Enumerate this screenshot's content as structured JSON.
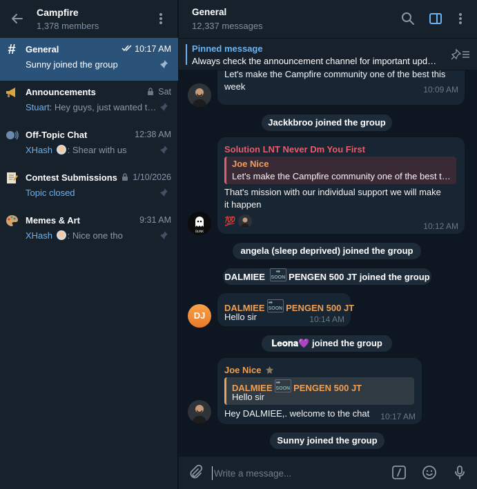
{
  "group": {
    "title": "Campfire",
    "members": "1,378 members"
  },
  "topics": [
    {
      "name": "General",
      "time": "10:17 AM",
      "preview": "Sunny joined the group",
      "icon": "#"
    },
    {
      "name": "Announcements",
      "time": "Sat",
      "sender": "Stuart:",
      "preview": " Hey guys, just wanted to share"
    },
    {
      "name": "Off-Topic Chat",
      "time": "12:38 AM",
      "sender": "XHash",
      "preview": ": Shear with us"
    },
    {
      "name": "Contest Submissions",
      "time": "1/10/2026",
      "preview": "Topic closed"
    },
    {
      "name": "Memes & Art",
      "time": "9:31 AM",
      "sender": "XHash",
      "preview": ": Nice one tho"
    }
  ],
  "channel": {
    "title": "General",
    "count": "12,337 messages"
  },
  "pinned": {
    "title": "Pinned message",
    "text": "Always check the announcement channel for important updates"
  },
  "messages": {
    "m1": {
      "text_line1": "Let's make the Campfire community one of the best this",
      "text_line2": "week",
      "time": "10:09 AM"
    },
    "svc1": "Jackkbroo joined the group",
    "m2": {
      "sender": "Solution LNT Never Dm You First",
      "quote_name": "Joe Nice",
      "quote_text": "Let's make the Campfire community one of the best this week",
      "text_line1": "That's mission with our individual support we will make",
      "text_line2": "it happen",
      "reaction": "💯",
      "time": "10:12 AM",
      "avatar_label": "BLINK"
    },
    "svc2": "angela (sleep deprived) joined the group",
    "svc3_name_a": "DALMIEE",
    "svc3_tag": "SOON",
    "svc3_name_b": "PENGEN 500 JT",
    "svc3_suffix": " joined the group",
    "m3": {
      "sender_a": "DALMIEE",
      "sender_tag": "SOON",
      "sender_b": "PENGEN 500 JT",
      "text": "Hello sir",
      "time": "10:14 AM",
      "initials": "DJ"
    },
    "svc4_name": "𝐋𝐞𝐨𝐧𝐚💜",
    "svc4_suffix": " joined the group",
    "m4": {
      "sender": "Joe Nice",
      "quote_name_a": "DALMIEE",
      "quote_tag": "SOON",
      "quote_name_b": "PENGEN 500 JT",
      "quote_text": "Hello sir",
      "text": "Hey DALMIEE,. welcome to the chat",
      "time": "10:17 AM"
    },
    "svc5": "Sunny joined the group"
  },
  "composer": {
    "placeholder": "Write a message..."
  },
  "colors": {
    "accent": "#6ab3f3",
    "active_topic": "#2b5278",
    "bubble": "#182533",
    "red_sender": "#e85d6c",
    "orange_sender": "#f0a054"
  }
}
